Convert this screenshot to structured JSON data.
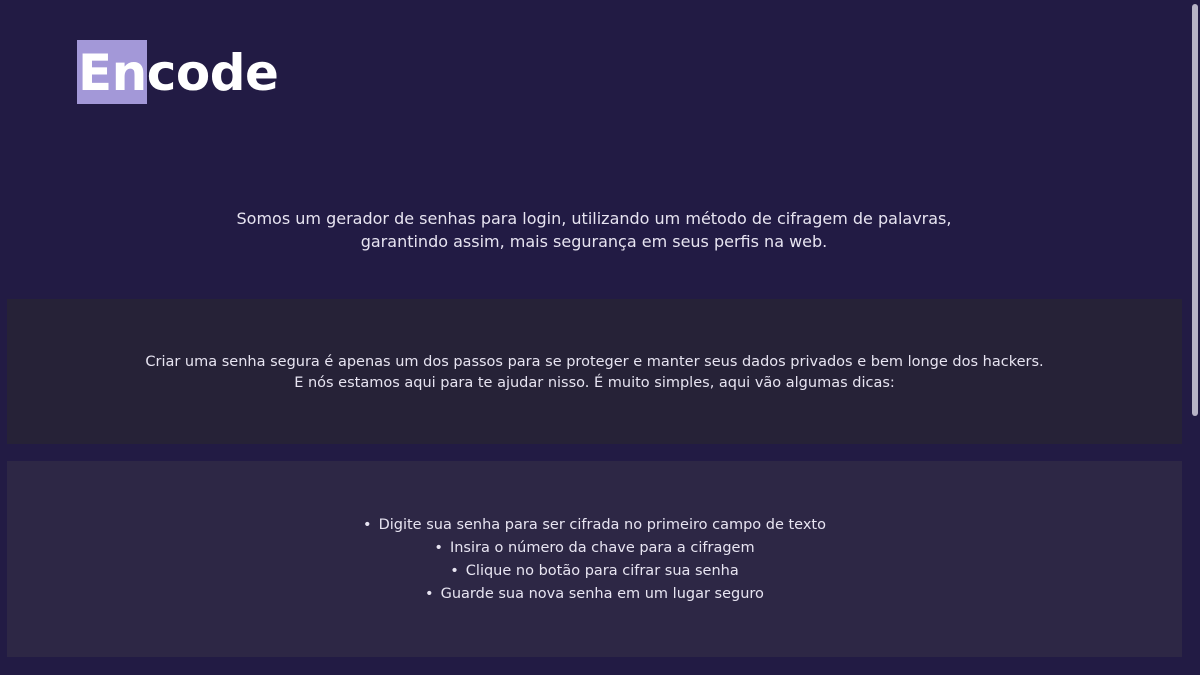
{
  "logo": {
    "highlight": "En",
    "rest": "code"
  },
  "intro": {
    "line1": "Somos um gerador de senhas para login, utilizando um método de cifragem de palavras,",
    "line2": "garantindo assim, mais segurança em seus perfis na web."
  },
  "info": {
    "line1": "Criar uma senha segura é apenas um dos passos para se proteger e manter seus dados privados e bem longe dos hackers.",
    "line2": "E nós estamos aqui para te ajudar nisso. É muito simples, aqui vão algumas dicas:"
  },
  "tips": [
    "Digite sua senha para ser cifrada no primeiro campo de texto",
    "Insira o número da chave para a cifragem",
    "Clique no botão para cifrar sua senha",
    "Guarde sua nova senha em um lugar seguro"
  ],
  "colors": {
    "background": "#221b44",
    "logo_highlight": "#a398d8",
    "panel_dark": "#262237",
    "panel_light": "#2d2745"
  }
}
